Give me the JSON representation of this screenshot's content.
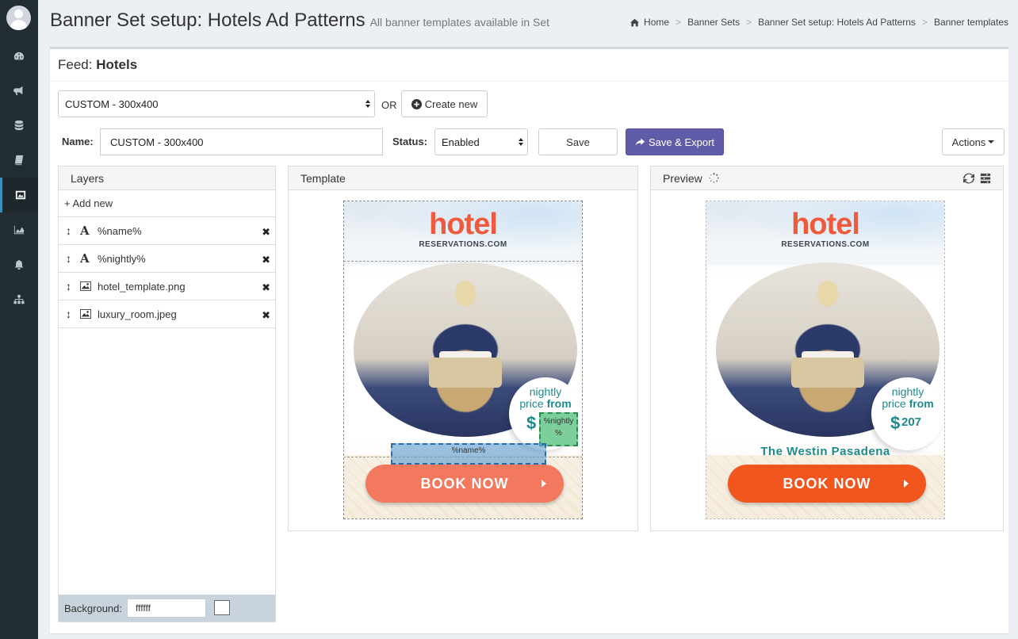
{
  "header": {
    "title": "Banner Set setup: Hotels Ad Patterns",
    "subtitle": "All banner templates available in Set",
    "breadcrumb": [
      "Home",
      "Banner Sets",
      "Banner Set setup: Hotels Ad Patterns",
      "Banner templates"
    ]
  },
  "sidebar": {
    "items": [
      {
        "icon": "dashboard-icon"
      },
      {
        "icon": "bullhorn-icon"
      },
      {
        "icon": "database-icon"
      },
      {
        "icon": "book-icon"
      },
      {
        "icon": "image-icon",
        "active": true
      },
      {
        "icon": "area-chart-icon"
      },
      {
        "icon": "bell-icon"
      },
      {
        "icon": "sitemap-icon"
      }
    ]
  },
  "feed": {
    "label": "Feed:",
    "value": "Hotels"
  },
  "template_select": {
    "value": "CUSTOM - 300x400"
  },
  "or_label": "OR",
  "create_new_label": "Create new",
  "form": {
    "name_label": "Name:",
    "name_value": "CUSTOM - 300x400",
    "status_label": "Status:",
    "status_value": "Enabled",
    "save_label": "Save",
    "save_export_label": "Save & Export",
    "actions_label": "Actions"
  },
  "layers": {
    "title": "Layers",
    "add_new_label": "+ Add new",
    "items": [
      {
        "type": "text",
        "name": "%name%"
      },
      {
        "type": "text",
        "name": "%nightly%"
      },
      {
        "type": "image",
        "name": "hotel_template.png"
      },
      {
        "type": "image",
        "name": "luxury_room.jpeg"
      }
    ],
    "background_label": "Background:",
    "background_value": "ffffff"
  },
  "template_panel": {
    "title": "Template",
    "name_placeholder": "%name%",
    "nightly_placeholder": "%nightly %"
  },
  "preview_panel": {
    "title": "Preview",
    "hotel_name": "The Westin Pasadena",
    "price": "207"
  },
  "banner": {
    "logo_word": "hotel",
    "logo_sub": "RESERVATIONS.COM",
    "price_line1": "nightly",
    "price_line2a": "price",
    "price_line2b": "from",
    "dollar": "$",
    "cta": "BOOK NOW"
  },
  "colors": {
    "sidebar": "#222d32",
    "accent": "#605ca8",
    "logo": "#ef5a3c",
    "teal": "#1f8a8c",
    "cta_template": "#f2795d",
    "cta_preview": "#f2561f"
  }
}
